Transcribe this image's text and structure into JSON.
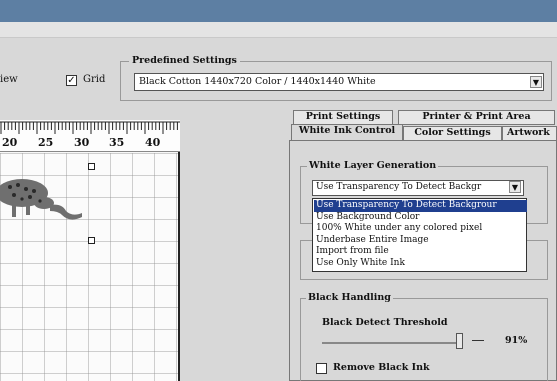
{
  "toolbar": {
    "view_label": "iew",
    "grid_label": "Grid",
    "grid_checked": true
  },
  "predefined": {
    "title": "Predefined Settings",
    "value": "Black Cotton 1440x720 Color / 1440x1440 White"
  },
  "ruler": {
    "labels": [
      "20",
      "25",
      "30",
      "35",
      "40"
    ]
  },
  "tabs": {
    "row_back": [
      "Print Settings",
      "Printer & Print Area"
    ],
    "row_front": [
      "White Ink Control",
      "Color Settings",
      "Artwork"
    ],
    "active": "White Ink Control"
  },
  "white_layer": {
    "title": "White Layer Generation",
    "selected": "Use Transparency To Detect Backgr",
    "options": [
      "Use Transparency To Detect Backgrour",
      "Use Background Color",
      "100% White under any colored pixel",
      "Underbase Entire Image",
      "Import from file",
      "Use Only White Ink"
    ],
    "highlighted_index": 0
  },
  "black_handling": {
    "title": "Black Handling",
    "threshold_label": "Black Detect Threshold",
    "threshold_value": "91%",
    "threshold_fraction": 0.91,
    "remove_label": "Remove Black Ink",
    "remove_checked": false
  },
  "colors": {
    "titlebar": "#5d7fa3",
    "panel": "#d8d8d8",
    "highlight": "#1f3f8f"
  }
}
